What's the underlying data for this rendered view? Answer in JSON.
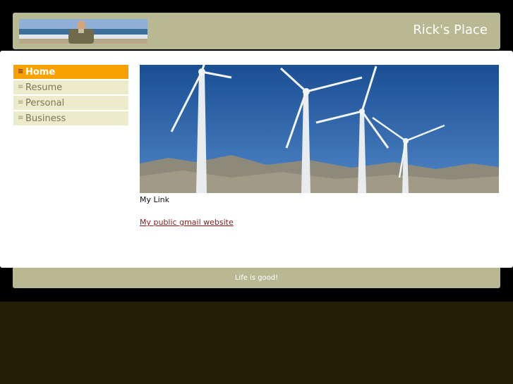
{
  "header": {
    "site_title": "Rick's Place",
    "photo_icon": "profile-photo"
  },
  "nav": {
    "items": [
      {
        "label": "Home",
        "active": true
      },
      {
        "label": "Resume",
        "active": false
      },
      {
        "label": "Personal",
        "active": false
      },
      {
        "label": "Business",
        "active": false
      }
    ],
    "active_color": "#f7a200",
    "inactive_color": "#ecebcc"
  },
  "content": {
    "banner_icon": "wind-turbines-banner",
    "section_heading": "My Link",
    "link_text": "My public gmail website",
    "link_color": "#8b1a1a"
  },
  "footer": {
    "text": "Life is good!"
  },
  "colors": {
    "frame": "#b8b892",
    "page_background": "#000000",
    "bottom_band": "#222004"
  }
}
